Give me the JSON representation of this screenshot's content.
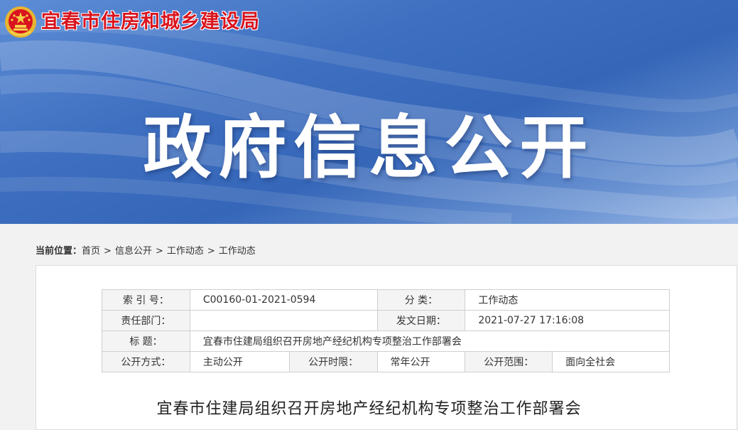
{
  "header": {
    "site_name": "宜春市住房和城乡建设局",
    "banner_title": "政府信息公开"
  },
  "breadcrumb": {
    "label": "当前位置：",
    "items": [
      "首页",
      "信息公开",
      "工作动态",
      "工作动态"
    ],
    "separator": ">"
  },
  "meta": {
    "index_label": "索 引 号：",
    "index_value": "C00160-01-2021-0594",
    "category_label": "分 类：",
    "category_value": "工作动态",
    "dept_label": "责任部门：",
    "dept_value": "",
    "date_label": "发文日期：",
    "date_value": "2021-07-27 17:16:08",
    "title_label": "标 题：",
    "title_value": "宜春市住建局组织召开房地产经纪机构专项整治工作部署会",
    "method_label": "公开方式：",
    "method_value": "主动公开",
    "period_label": "公开时限：",
    "period_value": "常年公开",
    "scope_label": "公开范围：",
    "scope_value": "面向全社会"
  },
  "article": {
    "title": "宜春市住建局组织召开房地产经纪机构专项整治工作部署会"
  },
  "colors": {
    "site_name": "#d9141e",
    "banner_blue": "#3566b8"
  }
}
